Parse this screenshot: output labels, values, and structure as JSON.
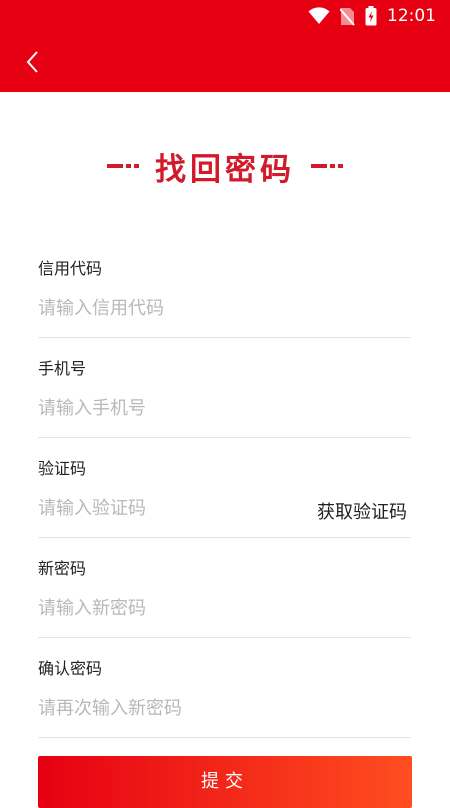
{
  "status_bar": {
    "time": "12:01",
    "icons": [
      "wifi-icon",
      "no-sim-icon",
      "battery-charging-icon"
    ]
  },
  "toolbar": {
    "back_icon": "chevron-left-icon"
  },
  "page": {
    "title": "找回密码"
  },
  "form": {
    "credit_code": {
      "label": "信用代码",
      "placeholder": "请输入信用代码"
    },
    "phone": {
      "label": "手机号",
      "placeholder": "请输入手机号"
    },
    "verify_code": {
      "label": "验证码",
      "placeholder": "请输入验证码",
      "action_label": "获取验证码"
    },
    "new_password": {
      "label": "新密码",
      "placeholder": "请输入新密码"
    },
    "confirm_password": {
      "label": "确认密码",
      "placeholder": "请再次输入新密码"
    }
  },
  "submit": {
    "label": "提交"
  },
  "colors": {
    "brand_red": "#e60012",
    "title_red": "#d11a2a",
    "button_gradient_end": "#ff4e20"
  }
}
